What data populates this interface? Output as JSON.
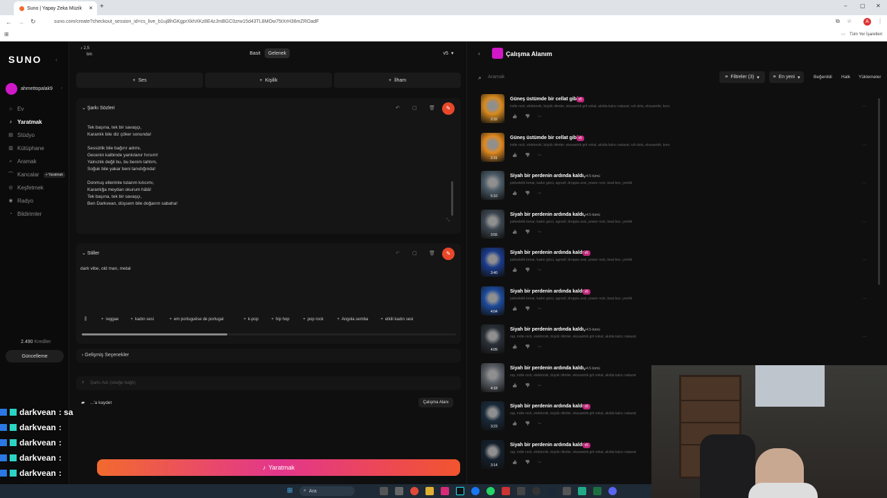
{
  "browser": {
    "tab_title": "Suno | Yapay Zeka Müzik",
    "url": "suno.com/create?checkout_session_id=cs_live_b1ujBhGKgprXkhXKz8E4zJmBGC0zrw15d43TL8MOw75tXrH38mZROadF",
    "bookmarks_label": "Tüm Yer İşaretleri",
    "profile_initial": "A"
  },
  "sidebar": {
    "logo": "SUNO",
    "username": "ahmettopalak9",
    "items": [
      {
        "label": "Ev",
        "icon": "home-icon"
      },
      {
        "label": "Yaratmak",
        "icon": "music-note-icon",
        "active": true
      },
      {
        "label": "Stüdyo",
        "icon": "studio-icon"
      },
      {
        "label": "Kütüphane",
        "icon": "library-icon"
      },
      {
        "label": "Aramak",
        "icon": "search-icon"
      },
      {
        "label": "Kancalar",
        "icon": "hook-icon",
        "badge": "+ Yaratmak"
      },
      {
        "label": "Keşfetmek",
        "icon": "compass-icon"
      },
      {
        "label": "Radyo",
        "icon": "radio-icon"
      },
      {
        "label": "Bildirimler",
        "icon": "bell-icon"
      }
    ],
    "credits": "2.490",
    "credits_label": "Krediler",
    "upgrade_label": "Güncelleme"
  },
  "center": {
    "count_value": "2,5",
    "count_unit": "bin",
    "mode_basic": "Basit",
    "mode_advanced": "Gelenek",
    "version": "v5",
    "add_audio": "Ses",
    "add_persona": "Kişilik",
    "add_inspo": "İlham",
    "lyrics_title": "Şarkı Sözleri",
    "lyrics": [
      "Tek başına, tek bir savaşçı,",
      "Karanlık bile diz çöker sonunda!",
      "",
      "Sessizlik bile bağırır adımı,",
      "Gecenin kalbinde yankılanır hırsım!",
      "Yalnızlık değil bu, bu benim tahtım,",
      "Soğuk bile yakar beni tanıdığında!",
      "",
      "Donmuş ellerimle tutarım kılıcımı,",
      "Karanlığa meydan okurum hâlâ!",
      "Tek başına, tek bir savaşçı,",
      "Ben Darkvean, düşsem bile doğarım sabaha!"
    ],
    "styles_title": "Stiller",
    "styles_value": "dark vibe, old man, metal",
    "style_chips": [
      "reggae",
      "kadın sesi",
      "em portuguêse de portugal",
      "k-pop",
      "hip hop",
      "pop rock",
      "Angola semba",
      "etkili kadın sesi"
    ],
    "advanced_options": "Gelişmiş Seçenekler",
    "song_title_placeholder": "Şarkı Adı (isteğe bağlı)",
    "save_to": "...'a kaydet",
    "workspace_btn": "Çalışma Alanı",
    "create_btn": "Yaratmak"
  },
  "right": {
    "title": "Çalışma Alanım",
    "search_placeholder": "Aramak",
    "filters_label": "Filtreler (3)",
    "sort_label": "En yeni",
    "tab_liked": "Beğenildi",
    "tab_public": "Halk",
    "tab_uploads": "Yüklemeler",
    "songs": [
      {
        "title": "Güneş üstümde bir cellat gibi,",
        "version": "v5",
        "tags": "indie rock, elektronik, büyük ritimler, ekssantrik grit vokal, akılda kalıcı nakarat, ruh dolu, ekssantrik, koro",
        "duration": "2:32",
        "color": "#d98a1e"
      },
      {
        "title": "Güneş üstümde bir cellat gibi,",
        "version": "v5",
        "tags": "indie rock, elektronik, büyük ritimler, ekssantrik grit vokal, akılda kalıcı nakarat, ruh dolu, ekssantrik, koro",
        "duration": "2:31",
        "color": "#e08a20"
      },
      {
        "title": "Siyah bir perdenin ardında kaldı,",
        "version": "v4.5-tümü",
        "tags": "psikedelik kenar, kadın gücü, agresif, droppia sesi, power rock, beat box, yenilik",
        "duration": "5:10",
        "color": "#4a5a66"
      },
      {
        "title": "Siyah bir perdenin ardında kaldı,",
        "version": "v4.5-tümü",
        "tags": "psikedelik kenar, kadın gücü, agresif, droppia sesi, power rock, beat box, yenilik",
        "duration": "3:55",
        "color": "#3c4650"
      },
      {
        "title": "Siyah bir perdenin ardında kaldı,",
        "version": "v5",
        "tags": "psikedelik kenar, kadın gücü, agresif, droppia sesi, power rock, beat box, yenilik",
        "duration": "3:40",
        "color": "#1a3a8a"
      },
      {
        "title": "Siyah bir perdenin ardında kaldı,",
        "version": "v5",
        "tags": "psikedelik kenar, kadın gücü, agresif, droppia sesi, power rock, beat box, yenilik",
        "duration": "4:04",
        "color": "#1c4a9a"
      },
      {
        "title": "Siyah bir perdenin ardında kaldı,",
        "version": "v4.5-tümü",
        "tags": "rap, indie rock, elektronik, büyük ritimler, ekssantrik grit vokal, akılda kalıcı nakarat",
        "duration": "4:09",
        "color": "#2a3038"
      },
      {
        "title": "Siyah bir perdenin ardında kaldı,",
        "version": "v4.5-tümü",
        "tags": "rap, indie rock, elektronik, büyük ritimler, ekssantrik grit vokal, akılda kalıcı nakarat",
        "duration": "4:18",
        "color": "#5a5f66"
      },
      {
        "title": "Siyah bir perdenin ardında kaldı,",
        "version": "v5",
        "tags": "rap, indie rock, elektronik, büyük ritimler, ekssantrik grit vokal, akılda kalıcı nakarat",
        "duration": "3:23",
        "color": "#1a2a3a"
      },
      {
        "title": "Siyah bir perdenin ardında kaldı,",
        "version": "v5",
        "tags": "rap, indie rock, elektronik, büyük ritimler, ekssantrik grit vokal, akılda kalıcı nakarat",
        "duration": "3:14",
        "color": "#14202c"
      }
    ]
  },
  "chat": [
    {
      "user": "darkvean",
      "message": ": sa"
    },
    {
      "user": "darkvean",
      "message": ":"
    },
    {
      "user": "darkvean",
      "message": ":"
    },
    {
      "user": "darkvean",
      "message": ":"
    },
    {
      "user": "darkvean",
      "message": ":"
    },
    {
      "user": "darkvean",
      "message": ":"
    }
  ],
  "taskbar": {
    "search_label": "Ara"
  },
  "colors": {
    "accent_orange": "#f26a2e",
    "accent_pink": "#e3368c",
    "background": "#0f0f0f"
  }
}
